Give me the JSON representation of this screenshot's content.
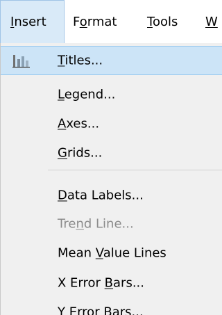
{
  "menubar": {
    "items": [
      {
        "label": "Insert",
        "active": true
      },
      {
        "label": "Format",
        "active": false
      },
      {
        "label": "Tools",
        "active": false
      },
      {
        "label": "W",
        "active": false
      }
    ]
  },
  "menu": {
    "items": [
      {
        "label": "Titles...",
        "state": "highlighted",
        "icon": "chart-insert-icon"
      },
      {
        "label": "Legend...",
        "state": "normal"
      },
      {
        "label": "Axes...",
        "state": "normal"
      },
      {
        "label": "Grids...",
        "state": "normal"
      },
      {
        "label": "Data Labels...",
        "state": "normal"
      },
      {
        "label": "Trend Line...",
        "state": "disabled"
      },
      {
        "label": "Mean Value Lines",
        "state": "normal"
      },
      {
        "label": "X Error Bars...",
        "state": "normal"
      },
      {
        "label": "Y Error Bars...",
        "state": "normal"
      }
    ]
  },
  "colors": {
    "menu_background": "#f0f0f0",
    "highlight": "#cce4f7",
    "highlight_border": "#99c9ef",
    "disabled_text": "#8b8b8b",
    "active_menu_background": "#d9eaf8"
  }
}
